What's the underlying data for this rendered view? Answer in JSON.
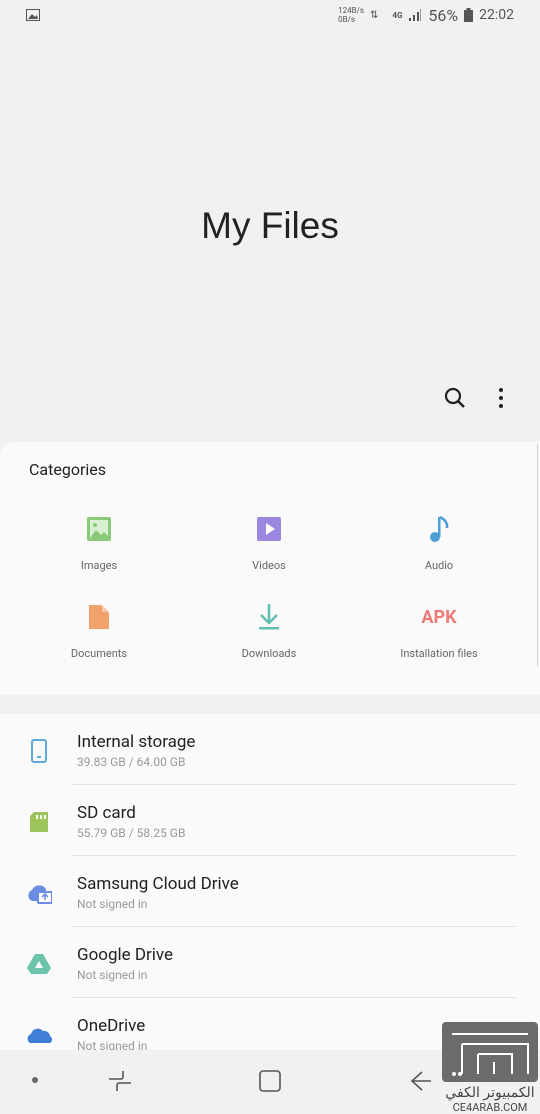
{
  "status_bar": {
    "speed_up": "124B/s",
    "speed_down": "0B/s",
    "network": "4G",
    "battery": "56%",
    "time": "22:02"
  },
  "header": {
    "title": "My Files"
  },
  "categories": {
    "heading": "Categories",
    "items": [
      {
        "label": "Images",
        "icon": "image-icon",
        "color": "#8bc97a"
      },
      {
        "label": "Videos",
        "icon": "video-icon",
        "color": "#9b86e0"
      },
      {
        "label": "Audio",
        "icon": "music-note-icon",
        "color": "#4f9ed6"
      },
      {
        "label": "Documents",
        "icon": "document-icon",
        "color": "#f0a26a"
      },
      {
        "label": "Downloads",
        "icon": "download-icon",
        "color": "#5fbfb0"
      },
      {
        "label": "Installation files",
        "icon": "apk-icon",
        "icon_text": "APK",
        "color": "#ee7b78"
      }
    ]
  },
  "storage": [
    {
      "name": "Internal storage",
      "detail": "39.83 GB / 64.00 GB",
      "icon": "phone-icon"
    },
    {
      "name": "SD card",
      "detail": "55.79 GB / 58.25 GB",
      "icon": "sd-card-icon"
    },
    {
      "name": "Samsung Cloud Drive",
      "detail": "Not signed in",
      "icon": "samsung-cloud-icon"
    },
    {
      "name": "Google Drive",
      "detail": "Not signed in",
      "icon": "google-drive-icon"
    },
    {
      "name": "OneDrive",
      "detail": "Not signed in",
      "icon": "onedrive-icon"
    }
  ],
  "watermark": {
    "arabic": "الكمبيوتر الكفي",
    "latin": "CE4ARAB.COM"
  }
}
